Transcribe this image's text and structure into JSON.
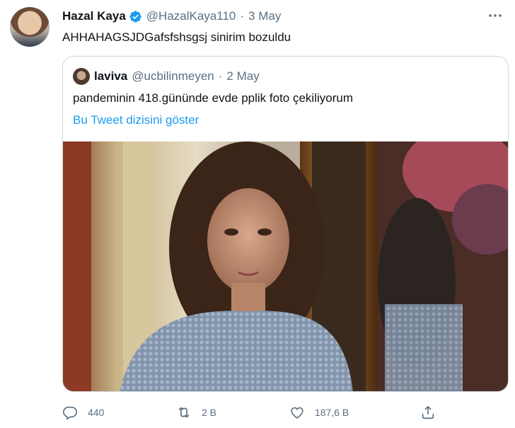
{
  "tweet": {
    "author_name": "Hazal Kaya",
    "author_handle": "@HazalKaya110",
    "separator": "·",
    "date": "3 May",
    "text": "AHHAHAGSJDGafsfshsgsj sinirim bozuldu",
    "verified": true
  },
  "quoted": {
    "author_name": "laviva",
    "author_handle": "@ucbilinmeyen",
    "separator": "·",
    "date": "2 May",
    "text": "pandeminin 418.gününde evde pplik foto çekiliyorum",
    "thread_link": "Bu Tweet dizisini göster"
  },
  "actions": {
    "reply_count": "440",
    "retweet_count": "2 B",
    "like_count": "187,6 B"
  },
  "icons": {
    "verified": "verified-badge-icon",
    "more": "more-options-icon",
    "reply": "reply-icon",
    "retweet": "retweet-icon",
    "like": "heart-icon",
    "share": "share-icon"
  },
  "colors": {
    "accent": "#1d9bf0",
    "muted": "#5b7083",
    "text": "#0f1419",
    "border": "#cfd9de"
  }
}
